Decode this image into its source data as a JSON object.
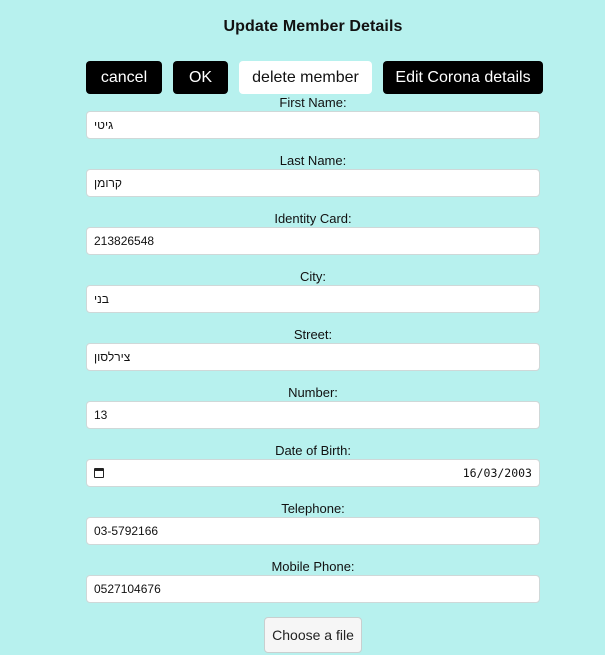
{
  "page": {
    "title": "Update Member Details"
  },
  "toolbar": {
    "cancel_label": "cancel",
    "ok_label": "OK",
    "delete_label": "delete member",
    "corona_label": "Edit Corona details"
  },
  "form": {
    "first_name": {
      "label": "First Name:",
      "value": "גיטי"
    },
    "last_name": {
      "label": "Last Name:",
      "value": "קרומן"
    },
    "identity_card": {
      "label": "Identity Card:",
      "value": "213826548"
    },
    "city": {
      "label": "City:",
      "value": "בני"
    },
    "street": {
      "label": "Street:",
      "value": "צירלסון"
    },
    "number": {
      "label": "Number:",
      "value": "13"
    },
    "date_of_birth": {
      "label": "Date of Birth:",
      "value": "16/03/2003"
    },
    "telephone": {
      "label": "Telephone:",
      "value": "03-5792166"
    },
    "mobile_phone": {
      "label": "Mobile Phone:",
      "value": "0527104676"
    }
  },
  "file_upload": {
    "button_label": "Choose a file"
  },
  "icons": {
    "date_picker": "calendar-icon"
  },
  "colors": {
    "background": "#b7f1ee",
    "primary_button": "#000000",
    "secondary_button": "#ffffff"
  }
}
